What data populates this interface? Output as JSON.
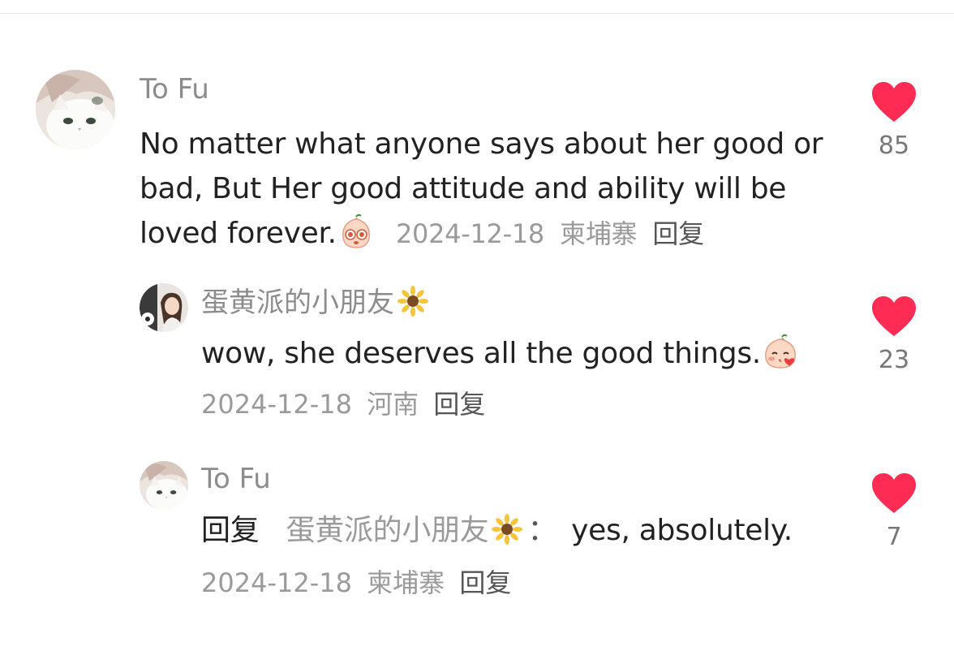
{
  "comments": [
    {
      "username": "To Fu",
      "text": "No matter what anyone says about her good or bad, But Her good attitude and ability will be loved forever.",
      "date": "2024-12-18",
      "location": "柬埔寨",
      "reply_label": "回复",
      "likes": "85",
      "emoji": "peach-face-big-eyes-emoji"
    },
    {
      "username": "蛋黄派的小朋友",
      "username_icon": "sunflower-icon",
      "text": "wow, she deserves all the good things.",
      "date": "2024-12-18",
      "location": "河南",
      "reply_label": "回复",
      "likes": "23",
      "emoji": "peach-face-kiss-emoji"
    },
    {
      "username": "To Fu",
      "reply_prefix": "回复",
      "reply_target": "蛋黄派的小朋友",
      "reply_target_icon": "sunflower-icon",
      "colon": "：",
      "text": "yes, absolutely.",
      "date": "2024-12-18",
      "location": "柬埔寨",
      "reply_label": "回复",
      "likes": "7"
    }
  ],
  "colors": {
    "heart": "#fe2c55",
    "username": "#8c8c8c",
    "text": "#222222",
    "meta": "#9a9a9a"
  }
}
